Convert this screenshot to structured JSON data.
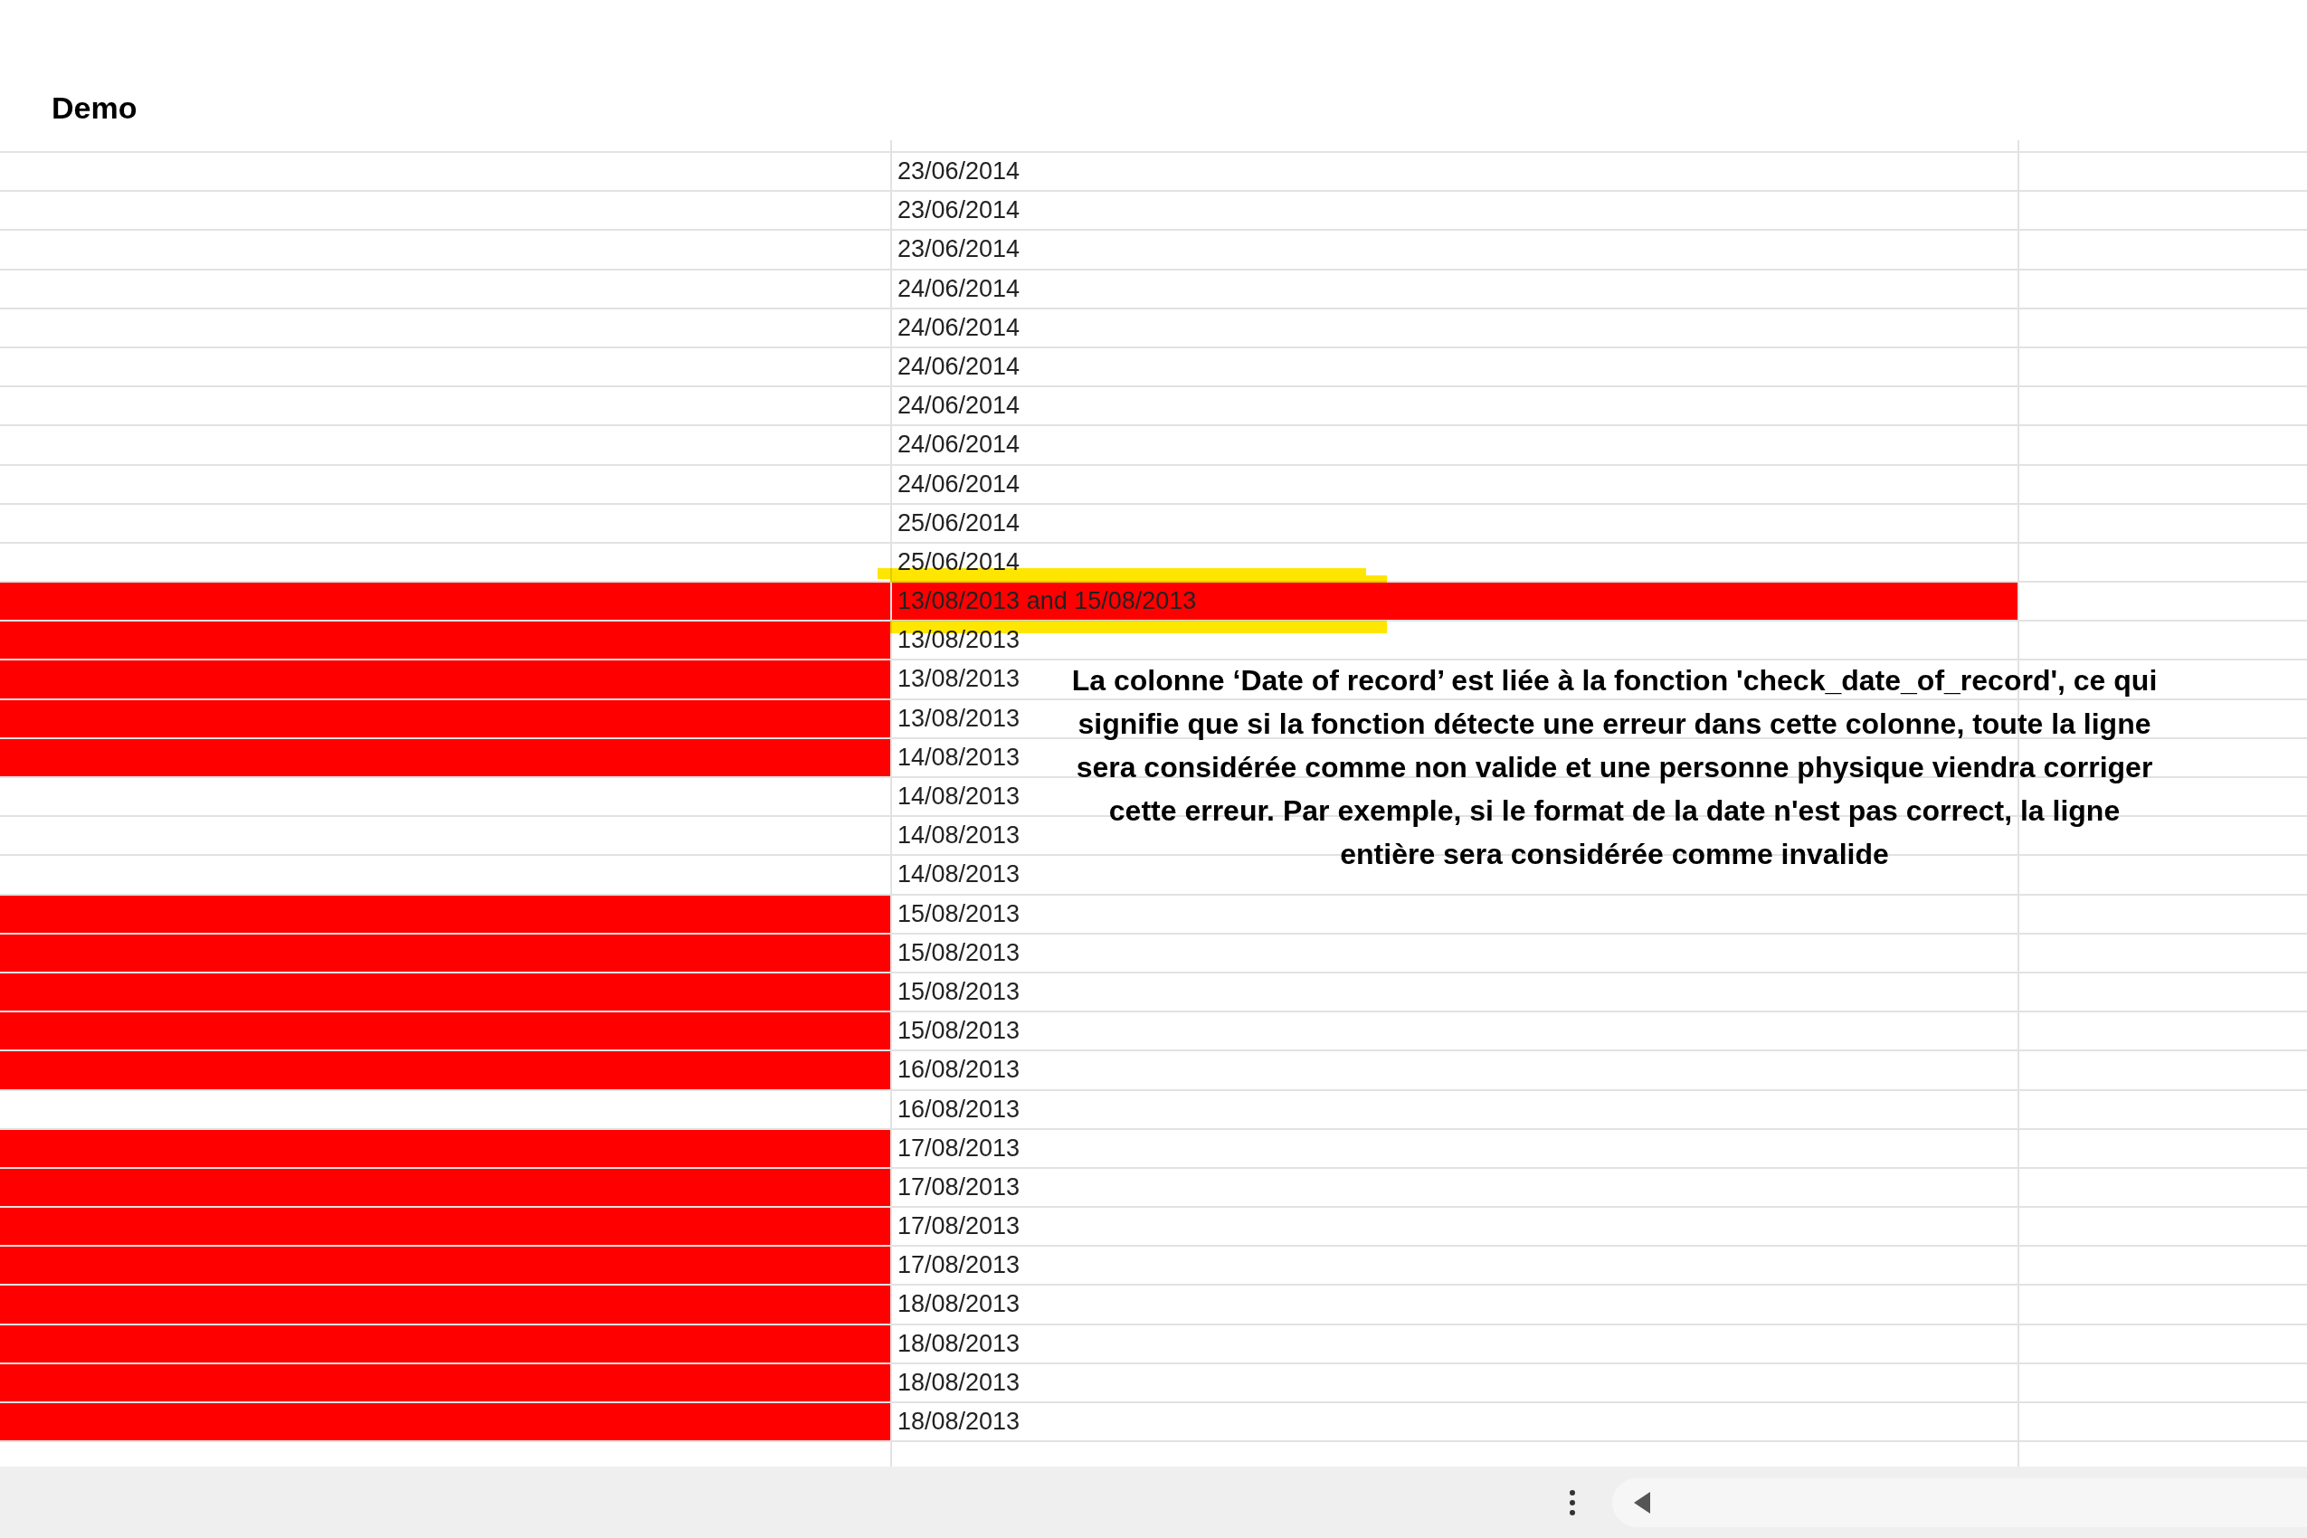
{
  "sheet_title": "Demo",
  "rows": [
    {
      "date": "23/06/2014",
      "flagged": false,
      "whole_row": false,
      "marked": false
    },
    {
      "date": "23/06/2014",
      "flagged": false,
      "whole_row": false,
      "marked": false
    },
    {
      "date": "23/06/2014",
      "flagged": false,
      "whole_row": false,
      "marked": false
    },
    {
      "date": "24/06/2014",
      "flagged": false,
      "whole_row": false,
      "marked": false
    },
    {
      "date": "24/06/2014",
      "flagged": false,
      "whole_row": false,
      "marked": false
    },
    {
      "date": "24/06/2014",
      "flagged": false,
      "whole_row": false,
      "marked": false
    },
    {
      "date": "24/06/2014",
      "flagged": false,
      "whole_row": false,
      "marked": false
    },
    {
      "date": "24/06/2014",
      "flagged": false,
      "whole_row": false,
      "marked": false
    },
    {
      "date": "24/06/2014",
      "flagged": false,
      "whole_row": false,
      "marked": false
    },
    {
      "date": "25/06/2014",
      "flagged": false,
      "whole_row": false,
      "marked": false
    },
    {
      "date": "25/06/2014",
      "flagged": false,
      "whole_row": false,
      "marked": false
    },
    {
      "date": "13/08/2013 and 15/08/2013",
      "flagged": true,
      "whole_row": true,
      "marked": true
    },
    {
      "date": "13/08/2013",
      "flagged": true,
      "whole_row": false,
      "marked": false
    },
    {
      "date": "13/08/2013",
      "flagged": true,
      "whole_row": false,
      "marked": false
    },
    {
      "date": "13/08/2013",
      "flagged": true,
      "whole_row": false,
      "marked": false
    },
    {
      "date": "14/08/2013",
      "flagged": true,
      "whole_row": false,
      "marked": false
    },
    {
      "date": "14/08/2013",
      "flagged": false,
      "whole_row": false,
      "marked": false
    },
    {
      "date": "14/08/2013",
      "flagged": false,
      "whole_row": false,
      "marked": false
    },
    {
      "date": "14/08/2013",
      "flagged": false,
      "whole_row": false,
      "marked": false
    },
    {
      "date": "15/08/2013",
      "flagged": true,
      "whole_row": false,
      "marked": false
    },
    {
      "date": "15/08/2013",
      "flagged": true,
      "whole_row": false,
      "marked": false
    },
    {
      "date": "15/08/2013",
      "flagged": true,
      "whole_row": false,
      "marked": false
    },
    {
      "date": "15/08/2013",
      "flagged": true,
      "whole_row": false,
      "marked": false
    },
    {
      "date": "16/08/2013",
      "flagged": true,
      "whole_row": false,
      "marked": false
    },
    {
      "date": "16/08/2013",
      "flagged": false,
      "whole_row": false,
      "marked": false
    },
    {
      "date": "17/08/2013",
      "flagged": true,
      "whole_row": false,
      "marked": false
    },
    {
      "date": "17/08/2013",
      "flagged": true,
      "whole_row": false,
      "marked": false
    },
    {
      "date": "17/08/2013",
      "flagged": true,
      "whole_row": false,
      "marked": false
    },
    {
      "date": "17/08/2013",
      "flagged": true,
      "whole_row": false,
      "marked": false
    },
    {
      "date": "18/08/2013",
      "flagged": true,
      "whole_row": false,
      "marked": false
    },
    {
      "date": "18/08/2013",
      "flagged": true,
      "whole_row": false,
      "marked": false
    },
    {
      "date": "18/08/2013",
      "flagged": true,
      "whole_row": false,
      "marked": false
    },
    {
      "date": "18/08/2013",
      "flagged": true,
      "whole_row": false,
      "marked": false
    }
  ],
  "annotation": "La colonne ‘Date of record’ est liée à la fonction 'check_date_of_record', ce qui signifie que si la fonction détecte une erreur dans cette colonne, toute la ligne sera considérée comme non valide et une personne physique viendra corriger cette erreur. Par exemple, si le format de la date n'est pas correct, la ligne entière sera considérée comme invalide"
}
